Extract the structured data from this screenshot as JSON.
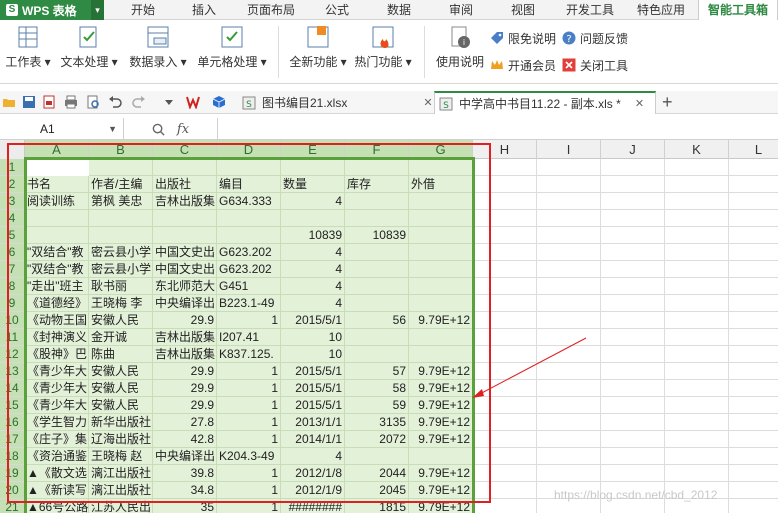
{
  "menubar": {
    "app_button": "WPS 表格",
    "tabs": [
      "开始",
      "插入",
      "页面布局",
      "公式",
      "数据",
      "审阅",
      "视图",
      "开发工具",
      "特色应用",
      "智能工具箱"
    ],
    "active_tab": "智能工具箱"
  },
  "ribbon": {
    "groups": [
      {
        "label": "工作表",
        "icon": "worksheet-icon"
      },
      {
        "label": "文本处理",
        "icon": "text-process-icon"
      },
      {
        "label": "数据录入",
        "icon": "data-entry-icon"
      },
      {
        "label": "单元格处理",
        "icon": "cell-process-icon"
      },
      {
        "label": "全新功能",
        "icon": "new-feature-icon"
      },
      {
        "label": "热门功能",
        "icon": "hot-feature-icon"
      },
      {
        "label": "使用说明",
        "icon": "help-info-icon"
      }
    ],
    "small_buttons": [
      "限免说明",
      "问题反馈",
      "开通会员",
      "关闭工具"
    ]
  },
  "doc_tabs": [
    {
      "label": "图书编目21.xlsx",
      "active": false
    },
    {
      "label": "中学高中书目11.22 - 副本.xls *",
      "active": true
    }
  ],
  "formula_bar": {
    "cell_ref": "A1",
    "fx": "fx",
    "content": ""
  },
  "columns": [
    "A",
    "B",
    "C",
    "D",
    "E",
    "F",
    "G",
    "H",
    "I",
    "J",
    "K",
    "L"
  ],
  "rows": [
    {
      "n": "1",
      "cells": [
        "",
        "",
        "",
        "",
        "",
        "",
        ""
      ]
    },
    {
      "n": "2",
      "cells": [
        "书名",
        "作者/主编",
        "出版社",
        "编目",
        "数量",
        "库存",
        "外借"
      ]
    },
    {
      "n": "3",
      "cells": [
        "阅读训练",
        "第枫 美忠",
        "吉林出版集",
        "G634.333",
        "4",
        "",
        ""
      ]
    },
    {
      "n": "4",
      "cells": [
        "",
        "",
        "",
        "",
        "",
        "",
        ""
      ]
    },
    {
      "n": "5",
      "cells": [
        "",
        "",
        "",
        "",
        "10839",
        "10839",
        ""
      ]
    },
    {
      "n": "6",
      "cells": [
        "\"双结合\"教",
        "密云县小学",
        "中国文史出",
        "G623.202",
        "4",
        "",
        ""
      ]
    },
    {
      "n": "7",
      "cells": [
        "\"双结合\"教",
        "密云县小学",
        "中国文史出",
        "G623.202",
        "4",
        "",
        ""
      ]
    },
    {
      "n": "8",
      "cells": [
        "\"走出\"班主",
        "耿书丽",
        "东北师范大",
        "G451",
        "4",
        "",
        ""
      ]
    },
    {
      "n": "9",
      "cells": [
        "《道德经》",
        "王晓梅 李",
        "中央编译出",
        "B223.1-49",
        "4",
        "",
        ""
      ]
    },
    {
      "n": "10",
      "cells": [
        "《动物王国",
        "安徽人民",
        "29.9",
        "1",
        "2015/5/1",
        "56",
        "9.79E+12"
      ]
    },
    {
      "n": "11",
      "cells": [
        "《封神演义",
        "金开诚",
        "吉林出版集",
        "I207.41",
        "10",
        "",
        ""
      ]
    },
    {
      "n": "12",
      "cells": [
        "《股神》巴",
        "陈曲",
        "吉林出版集",
        "K837.125.",
        "10",
        "",
        ""
      ]
    },
    {
      "n": "13",
      "cells": [
        "《青少年大",
        "安徽人民",
        "29.9",
        "1",
        "2015/5/1",
        "57",
        "9.79E+12"
      ]
    },
    {
      "n": "14",
      "cells": [
        "《青少年大",
        "安徽人民",
        "29.9",
        "1",
        "2015/5/1",
        "58",
        "9.79E+12"
      ]
    },
    {
      "n": "15",
      "cells": [
        "《青少年大",
        "安徽人民",
        "29.9",
        "1",
        "2015/5/1",
        "59",
        "9.79E+12"
      ]
    },
    {
      "n": "16",
      "cells": [
        "《学生智力",
        "新华出版社",
        "27.8",
        "1",
        "2013/1/1",
        "3135",
        "9.79E+12"
      ]
    },
    {
      "n": "17",
      "cells": [
        "《庄子》集",
        "辽海出版社",
        "42.8",
        "1",
        "2014/1/1",
        "2072",
        "9.79E+12"
      ]
    },
    {
      "n": "18",
      "cells": [
        "《资治通鉴",
        "王晓梅 赵",
        "中央编译出",
        "K204.3-49",
        "4",
        "",
        ""
      ]
    },
    {
      "n": "19",
      "cells": [
        "▲《散文选",
        "漓江出版社",
        "39.8",
        "1",
        "2012/1/8",
        "2044",
        "9.79E+12"
      ]
    },
    {
      "n": "20",
      "cells": [
        "▲《新读写",
        "漓江出版社",
        "34.8",
        "1",
        "2012/1/9",
        "2045",
        "9.79E+12"
      ]
    },
    {
      "n": "21",
      "cells": [
        "▲66号公路",
        "江苏人民出",
        "35",
        "1",
        "########",
        "1815",
        "9.79E+12"
      ]
    }
  ],
  "watermark": "https://blog.csdn.net/cbd_2012",
  "colors": {
    "accent": "#2f8a43",
    "selection": "#5aa13c",
    "annotation": "#e02020"
  }
}
